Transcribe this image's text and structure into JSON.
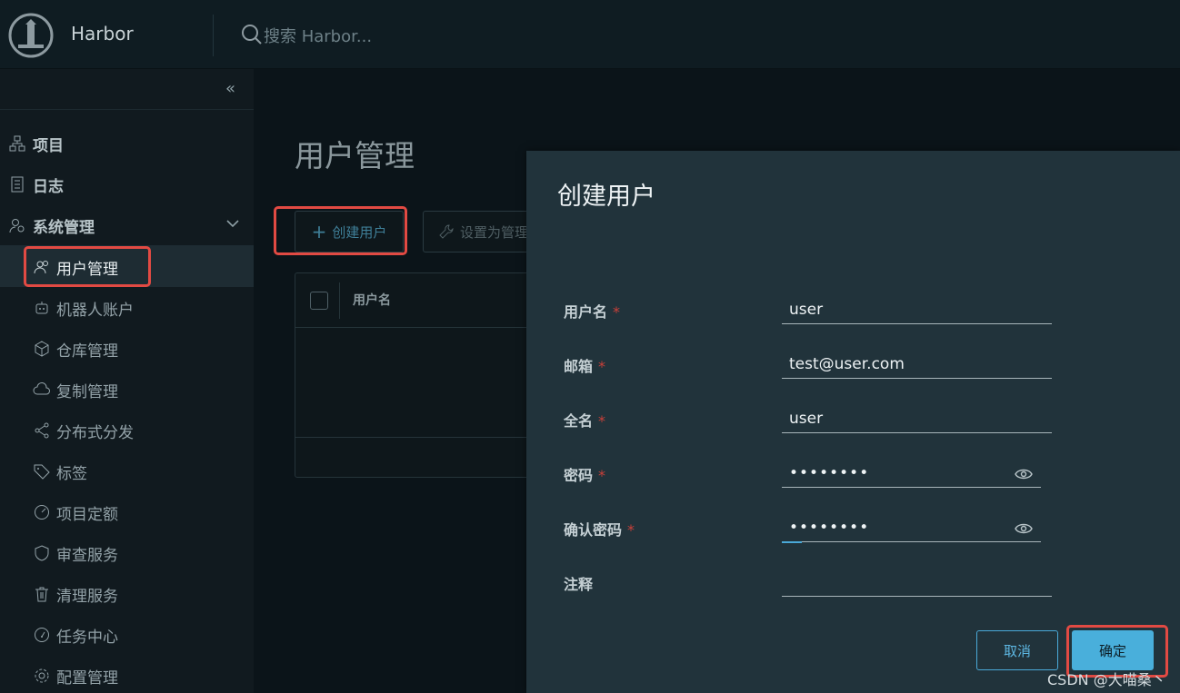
{
  "header": {
    "app_title": "Harbor",
    "search_placeholder": "搜索 Harbor..."
  },
  "sidebar": {
    "collapse_icon": "«",
    "items": [
      {
        "label": "项目",
        "icon": "projects-icon"
      },
      {
        "label": "日志",
        "icon": "logs-icon"
      },
      {
        "label": "系统管理",
        "icon": "admin-icon"
      }
    ],
    "sub_items": [
      {
        "label": "用户管理",
        "icon": "users-icon",
        "active": true
      },
      {
        "label": "机器人账户",
        "icon": "robot-icon"
      },
      {
        "label": "仓库管理",
        "icon": "registry-icon"
      },
      {
        "label": "复制管理",
        "icon": "replication-icon"
      },
      {
        "label": "分布式分发",
        "icon": "share-icon"
      },
      {
        "label": "标签",
        "icon": "tag-icon"
      },
      {
        "label": "项目定额",
        "icon": "quota-icon"
      },
      {
        "label": "审查服务",
        "icon": "shield-icon"
      },
      {
        "label": "清理服务",
        "icon": "trash-icon"
      },
      {
        "label": "任务中心",
        "icon": "dashboard-icon"
      },
      {
        "label": "配置管理",
        "icon": "gear-icon"
      }
    ]
  },
  "main": {
    "page_title": "用户管理",
    "create_button": "创建用户",
    "set_admin_button": "设置为管理",
    "column_username": "用户名"
  },
  "modal": {
    "title": "创建用户",
    "fields": [
      {
        "label": "用户名",
        "required": "*",
        "value": "user"
      },
      {
        "label": "邮箱",
        "required": "*",
        "value": "test@user.com"
      },
      {
        "label": "全名",
        "required": "*",
        "value": "user"
      },
      {
        "label": "密码",
        "required": "*",
        "value": "••••••••"
      },
      {
        "label": "确认密码",
        "required": "*",
        "value": "••••••••"
      },
      {
        "label": "注释",
        "required": "",
        "value": ""
      }
    ],
    "cancel_label": "取消",
    "ok_label": "确定"
  },
  "watermark": "CSDN @大喵桑丶",
  "colors": {
    "accent": "#49afdb",
    "highlight_box": "#e24a43",
    "required": "#c9403a"
  }
}
